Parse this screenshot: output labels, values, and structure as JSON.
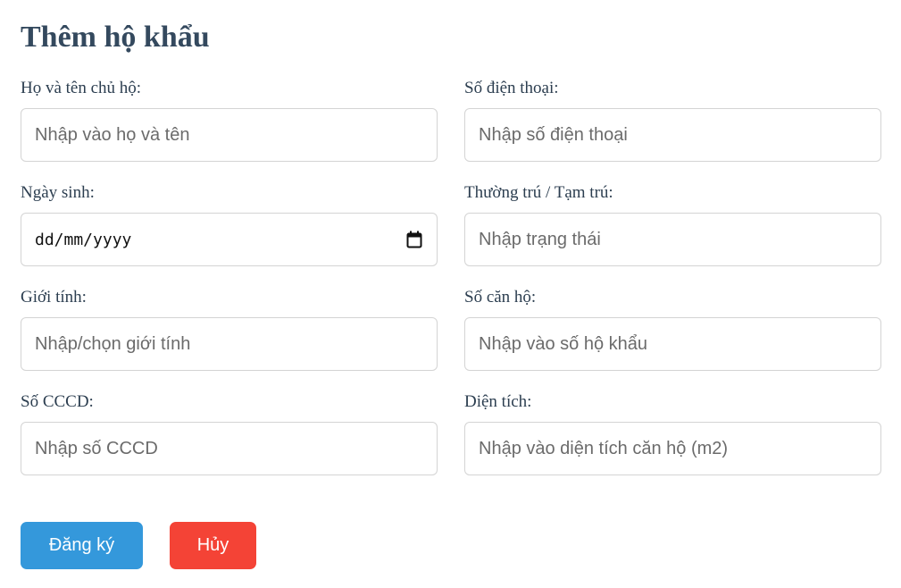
{
  "page": {
    "title": "Thêm hộ khẩu"
  },
  "form": {
    "fields": [
      {
        "label": "Họ và tên chủ hộ:",
        "placeholder": "Nhập vào họ và tên",
        "value": ""
      },
      {
        "label": "Số điện thoại:",
        "placeholder": "Nhập số điện thoại",
        "value": ""
      },
      {
        "label": "Ngày sinh:",
        "placeholder": "dd/mm/yyyy",
        "value": ""
      },
      {
        "label": "Thường trú / Tạm trú:",
        "placeholder": "Nhập trạng thái",
        "value": ""
      },
      {
        "label": "Giới tính:",
        "placeholder": "Nhập/chọn giới tính",
        "value": ""
      },
      {
        "label": "Số căn hộ:",
        "placeholder": "Nhập vào số hộ khẩu",
        "value": ""
      },
      {
        "label": "Số CCCD:",
        "placeholder": "Nhập số CCCD",
        "value": ""
      },
      {
        "label": "Diện tích:",
        "placeholder": "Nhập vào diện tích căn hộ (m2)",
        "value": ""
      }
    ]
  },
  "buttons": {
    "submit_label": "Đăng ký",
    "cancel_label": "Hủy"
  },
  "icons": {
    "date_picker": "calendar-icon"
  },
  "colors": {
    "title": "#34495e",
    "submit": "#3498db",
    "cancel": "#f44336",
    "input_border": "#d4d4d4"
  }
}
